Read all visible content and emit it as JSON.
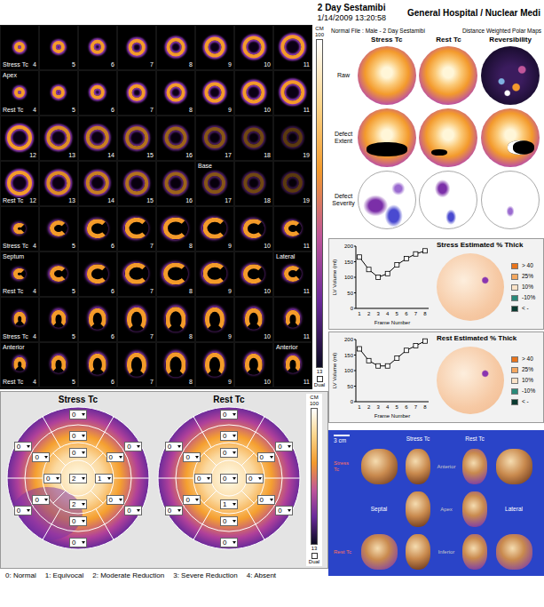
{
  "header": {
    "study": "2 Day Sestamibi",
    "datetime": "1/14/2009  13:20:58",
    "site": "General Hospital / Nuclear Medi"
  },
  "slices": {
    "rows": [
      {
        "label": "Stress Tc",
        "kind": "short",
        "cells": [
          {
            "n": "4"
          },
          {
            "n": "5"
          },
          {
            "n": "6"
          },
          {
            "n": "7"
          },
          {
            "n": "8"
          },
          {
            "n": "9"
          },
          {
            "n": "10"
          },
          {
            "n": "11"
          }
        ]
      },
      {
        "label": "Rest Tc",
        "kind": "short",
        "cells": [
          {
            "n": "4",
            "tag": "Apex"
          },
          {
            "n": "5"
          },
          {
            "n": "6"
          },
          {
            "n": "7"
          },
          {
            "n": "8"
          },
          {
            "n": "9"
          },
          {
            "n": "10"
          },
          {
            "n": "11"
          }
        ]
      },
      {
        "kind": "short",
        "cells": [
          {
            "n": "12"
          },
          {
            "n": "13"
          },
          {
            "n": "14"
          },
          {
            "n": "15"
          },
          {
            "n": "16"
          },
          {
            "n": "17"
          },
          {
            "n": "18"
          },
          {
            "n": "19"
          }
        ]
      },
      {
        "label": "Rest Tc",
        "kind": "short",
        "cells": [
          {
            "n": "12"
          },
          {
            "n": "13"
          },
          {
            "n": "14"
          },
          {
            "n": "15"
          },
          {
            "n": "16"
          },
          {
            "n": "17",
            "tag": "Base"
          },
          {
            "n": "18"
          },
          {
            "n": "19"
          }
        ]
      },
      {
        "label": "Stress Tc",
        "kind": "vla",
        "cells": [
          {
            "n": "4"
          },
          {
            "n": "5"
          },
          {
            "n": "6"
          },
          {
            "n": "7"
          },
          {
            "n": "8"
          },
          {
            "n": "9"
          },
          {
            "n": "10"
          },
          {
            "n": "11"
          }
        ]
      },
      {
        "label": "Rest Tc",
        "kind": "vla",
        "cells": [
          {
            "n": "4",
            "tag": "Septum"
          },
          {
            "n": "5"
          },
          {
            "n": "6"
          },
          {
            "n": "7"
          },
          {
            "n": "8"
          },
          {
            "n": "9"
          },
          {
            "n": "10"
          },
          {
            "n": "11",
            "tag": "Lateral"
          }
        ]
      },
      {
        "label": "Stress Tc",
        "kind": "hla",
        "cells": [
          {
            "n": "4"
          },
          {
            "n": "5"
          },
          {
            "n": "6"
          },
          {
            "n": "7"
          },
          {
            "n": "8"
          },
          {
            "n": "9"
          },
          {
            "n": "10"
          },
          {
            "n": "11"
          }
        ]
      },
      {
        "label": "Rest Tc",
        "kind": "hla",
        "cells": [
          {
            "n": "4",
            "tag": "Anterior"
          },
          {
            "n": "5"
          },
          {
            "n": "6"
          },
          {
            "n": "7"
          },
          {
            "n": "8"
          },
          {
            "n": "9"
          },
          {
            "n": "10"
          },
          {
            "n": "11",
            "tag": "Anterior"
          }
        ]
      }
    ],
    "scale": {
      "unit": "CM",
      "max": "100",
      "min": "13",
      "dual": {
        "label": "Dual",
        "checked": false
      }
    }
  },
  "polar": {
    "normal_file": "Normal File : Male - 2 Day Sestamibi",
    "title": "Distance Weighted Polar Maps",
    "columns": [
      "Stress Tc",
      "Rest Tc",
      "Reversibility"
    ],
    "rows": [
      {
        "label": "Raw",
        "kind": "raw"
      },
      {
        "label": "Defect Extent",
        "kind": "extent"
      },
      {
        "label": "Defect Severity",
        "kind": "severity"
      }
    ]
  },
  "thickening": [
    {
      "chart": {
        "y_label": "LV Volume (ml)",
        "x_label": "Frame Number",
        "y_ticks": [
          "0",
          "50",
          "100",
          "150",
          "200"
        ],
        "x_ticks": [
          "1",
          "2",
          "3",
          "4",
          "5",
          "6",
          "7",
          "8"
        ],
        "values": [
          165,
          125,
          100,
          112,
          140,
          160,
          175,
          185
        ]
      },
      "title": "Stress Estimated % Thick",
      "legend": [
        {
          "text": "> 40",
          "color": "#e8741c"
        },
        {
          "text": "25%",
          "color": "#f4a860"
        },
        {
          "text": "10%",
          "color": "#fbe3c8"
        },
        {
          "text": "-10%",
          "color": "#2a8a7a"
        },
        {
          "text": "< -",
          "color": "#0a3a30"
        }
      ]
    },
    {
      "chart": {
        "y_label": "LV Volume (ml)",
        "x_label": "Frame Number",
        "y_ticks": [
          "0",
          "50",
          "100",
          "150",
          "200"
        ],
        "x_ticks": [
          "1",
          "2",
          "3",
          "4",
          "5",
          "6",
          "7",
          "8"
        ],
        "values": [
          170,
          132,
          115,
          115,
          140,
          165,
          180,
          195
        ]
      },
      "title": "Rest Estimated % Thick",
      "legend": [
        {
          "text": "> 40",
          "color": "#e8741c"
        },
        {
          "text": "25%",
          "color": "#f4a860"
        },
        {
          "text": "10%",
          "color": "#fbe3c8"
        },
        {
          "text": "-10%",
          "color": "#2a8a7a"
        },
        {
          "text": "< -",
          "color": "#0a3a30"
        }
      ]
    }
  ],
  "surface": {
    "scale": "3 cm",
    "columns": [
      "Stress Tc",
      "Rest Tc"
    ],
    "rows": [
      "Stress Tc",
      "Rest Tc"
    ],
    "septal": "Septal",
    "lateral": "Lateral",
    "axes": [
      "Anterior",
      "Apex",
      "Inferior"
    ]
  },
  "scoring": {
    "maps": [
      {
        "title": "Stress Tc",
        "scores": [
          "0",
          "0",
          "0",
          "0",
          "0",
          "0",
          "0",
          "0",
          "0",
          "0",
          "0",
          "0",
          "0",
          "0",
          "2",
          "1",
          "2"
        ]
      },
      {
        "title": "Rest Tc",
        "scores": [
          "0",
          "0",
          "0",
          "0",
          "0",
          "0",
          "0",
          "0",
          "0",
          "0",
          "0",
          "0",
          "0",
          "0",
          "1",
          "0",
          "0"
        ]
      }
    ],
    "scale": {
      "unit": "CM",
      "max": "100",
      "min": "13",
      "dual": {
        "label": "Dual",
        "checked": false
      }
    },
    "legend": [
      "0: Normal",
      "1: Equivocal",
      "2: Moderate Reduction",
      "3: Severe Reduction",
      "4: Absent"
    ]
  }
}
